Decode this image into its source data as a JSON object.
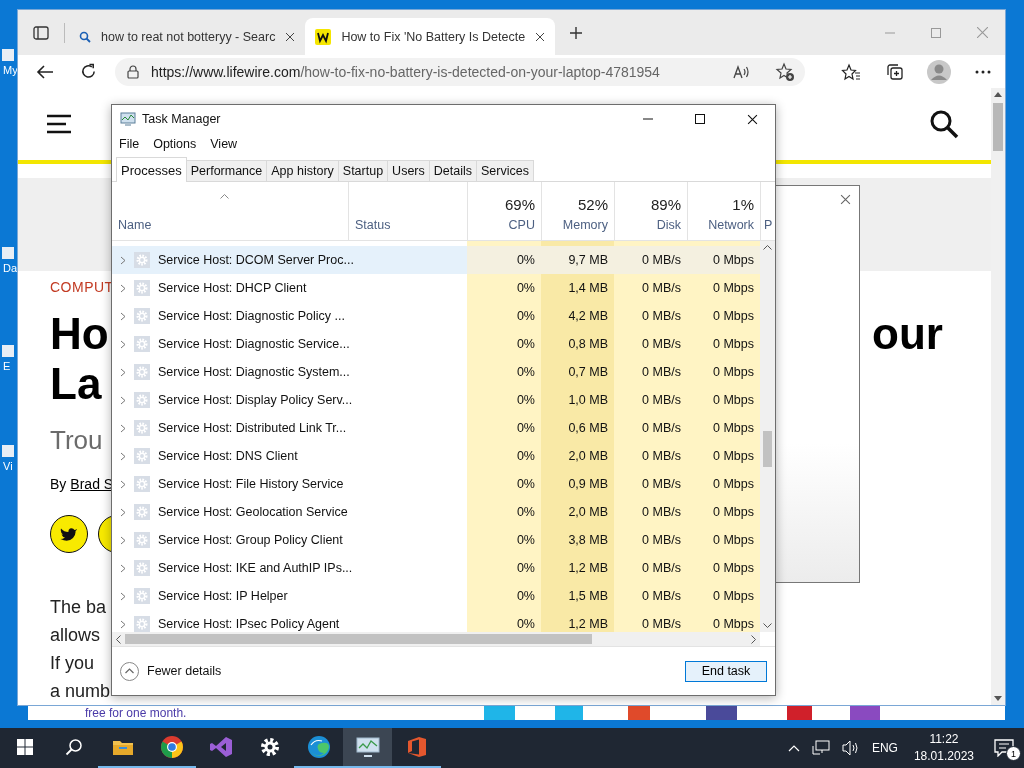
{
  "desktop": {
    "icons": [
      {
        "label": "My"
      },
      {
        "label": "Da"
      },
      {
        "label": "E"
      },
      {
        "label": "Vi"
      }
    ],
    "back_window": {
      "text": "free for one month."
    }
  },
  "browser": {
    "tabs": [
      {
        "title": "how to reat not botteryy - Searc",
        "kind": "search",
        "selected": false
      },
      {
        "title": "How to Fix 'No Battery Is Detecte",
        "kind": "site",
        "selected": true
      }
    ],
    "url_host": "https://www.lifewire.com",
    "url_path": "/how-to-fix-no-battery-is-detected-on-your-laptop-4781954",
    "page": {
      "category": "COMPUT",
      "headline_left": [
        "Ho",
        "La"
      ],
      "headline_right": "our",
      "subtitle": "Trou",
      "byline": "By",
      "author": "Brad S",
      "paragraph": [
        "The ba",
        "allows",
        "If you",
        "a numb"
      ]
    }
  },
  "task_manager": {
    "title": "Task Manager",
    "menu": [
      "File",
      "Options",
      "View"
    ],
    "tabs": [
      {
        "label": "Processes",
        "selected": true
      },
      {
        "label": "Performance",
        "selected": false
      },
      {
        "label": "App history",
        "selected": false
      },
      {
        "label": "Startup",
        "selected": false
      },
      {
        "label": "Users",
        "selected": false
      },
      {
        "label": "Details",
        "selected": false
      },
      {
        "label": "Services",
        "selected": false
      }
    ],
    "columns": [
      {
        "label": "Name",
        "kind": "text"
      },
      {
        "label": "Status",
        "kind": "text"
      },
      {
        "usage": "69%",
        "label": "CPU",
        "kind": "metric"
      },
      {
        "usage": "52%",
        "label": "Memory",
        "kind": "metric"
      },
      {
        "usage": "89%",
        "label": "Disk",
        "kind": "metric"
      },
      {
        "usage": "1%",
        "label": "Network",
        "kind": "metric"
      },
      {
        "label": "P",
        "kind": "cut"
      }
    ],
    "rows": [
      {
        "name": "Service Host: DCOM Server Proc...",
        "cpu": "0%",
        "memory": "9,7 MB",
        "disk": "0 MB/s",
        "network": "0 Mbps",
        "highlighted": true
      },
      {
        "name": "Service Host: DHCP Client",
        "cpu": "0%",
        "memory": "1,4 MB",
        "disk": "0 MB/s",
        "network": "0 Mbps",
        "highlighted": false
      },
      {
        "name": "Service Host: Diagnostic Policy ...",
        "cpu": "0%",
        "memory": "4,2 MB",
        "disk": "0 MB/s",
        "network": "0 Mbps",
        "highlighted": false
      },
      {
        "name": "Service Host: Diagnostic Service...",
        "cpu": "0%",
        "memory": "0,8 MB",
        "disk": "0 MB/s",
        "network": "0 Mbps",
        "highlighted": false
      },
      {
        "name": "Service Host: Diagnostic System...",
        "cpu": "0%",
        "memory": "0,7 MB",
        "disk": "0 MB/s",
        "network": "0 Mbps",
        "highlighted": false
      },
      {
        "name": "Service Host: Display Policy Serv...",
        "cpu": "0%",
        "memory": "1,0 MB",
        "disk": "0 MB/s",
        "network": "0 Mbps",
        "highlighted": false
      },
      {
        "name": "Service Host: Distributed Link Tr...",
        "cpu": "0%",
        "memory": "0,6 MB",
        "disk": "0 MB/s",
        "network": "0 Mbps",
        "highlighted": false
      },
      {
        "name": "Service Host: DNS Client",
        "cpu": "0%",
        "memory": "2,0 MB",
        "disk": "0 MB/s",
        "network": "0 Mbps",
        "highlighted": false
      },
      {
        "name": "Service Host: File History Service",
        "cpu": "0%",
        "memory": "0,9 MB",
        "disk": "0 MB/s",
        "network": "0 Mbps",
        "highlighted": false
      },
      {
        "name": "Service Host: Geolocation Service",
        "cpu": "0%",
        "memory": "2,0 MB",
        "disk": "0 MB/s",
        "network": "0 Mbps",
        "highlighted": false
      },
      {
        "name": "Service Host: Group Policy Client",
        "cpu": "0%",
        "memory": "3,8 MB",
        "disk": "0 MB/s",
        "network": "0 Mbps",
        "highlighted": false
      },
      {
        "name": "Service Host: IKE and AuthIP IPs...",
        "cpu": "0%",
        "memory": "1,2 MB",
        "disk": "0 MB/s",
        "network": "0 Mbps",
        "highlighted": false
      },
      {
        "name": "Service Host: IP Helper",
        "cpu": "0%",
        "memory": "1,5 MB",
        "disk": "0 MB/s",
        "network": "0 Mbps",
        "highlighted": false
      },
      {
        "name": "Service Host: IPsec Policy Agent",
        "cpu": "0%",
        "memory": "1,2 MB",
        "disk": "0 MB/s",
        "network": "0 Mbps",
        "highlighted": false
      }
    ],
    "fewer_details": "Fewer details",
    "end_task": "End task"
  },
  "taskbar": {
    "apps": [
      {
        "kind": "start",
        "running": false,
        "active": false
      },
      {
        "kind": "search",
        "running": false,
        "active": false
      },
      {
        "kind": "folder",
        "running": true,
        "active": false
      },
      {
        "kind": "chrome",
        "running": true,
        "active": false
      },
      {
        "kind": "studio",
        "running": false,
        "active": false
      },
      {
        "kind": "settings",
        "running": false,
        "active": false
      },
      {
        "kind": "edge",
        "running": true,
        "active": false
      },
      {
        "kind": "taskmgr",
        "running": true,
        "active": true
      },
      {
        "kind": "office",
        "running": true,
        "active": false
      }
    ],
    "language": "ENG",
    "time": "11:22",
    "date": "18.01.2023",
    "notifications": "1"
  }
}
